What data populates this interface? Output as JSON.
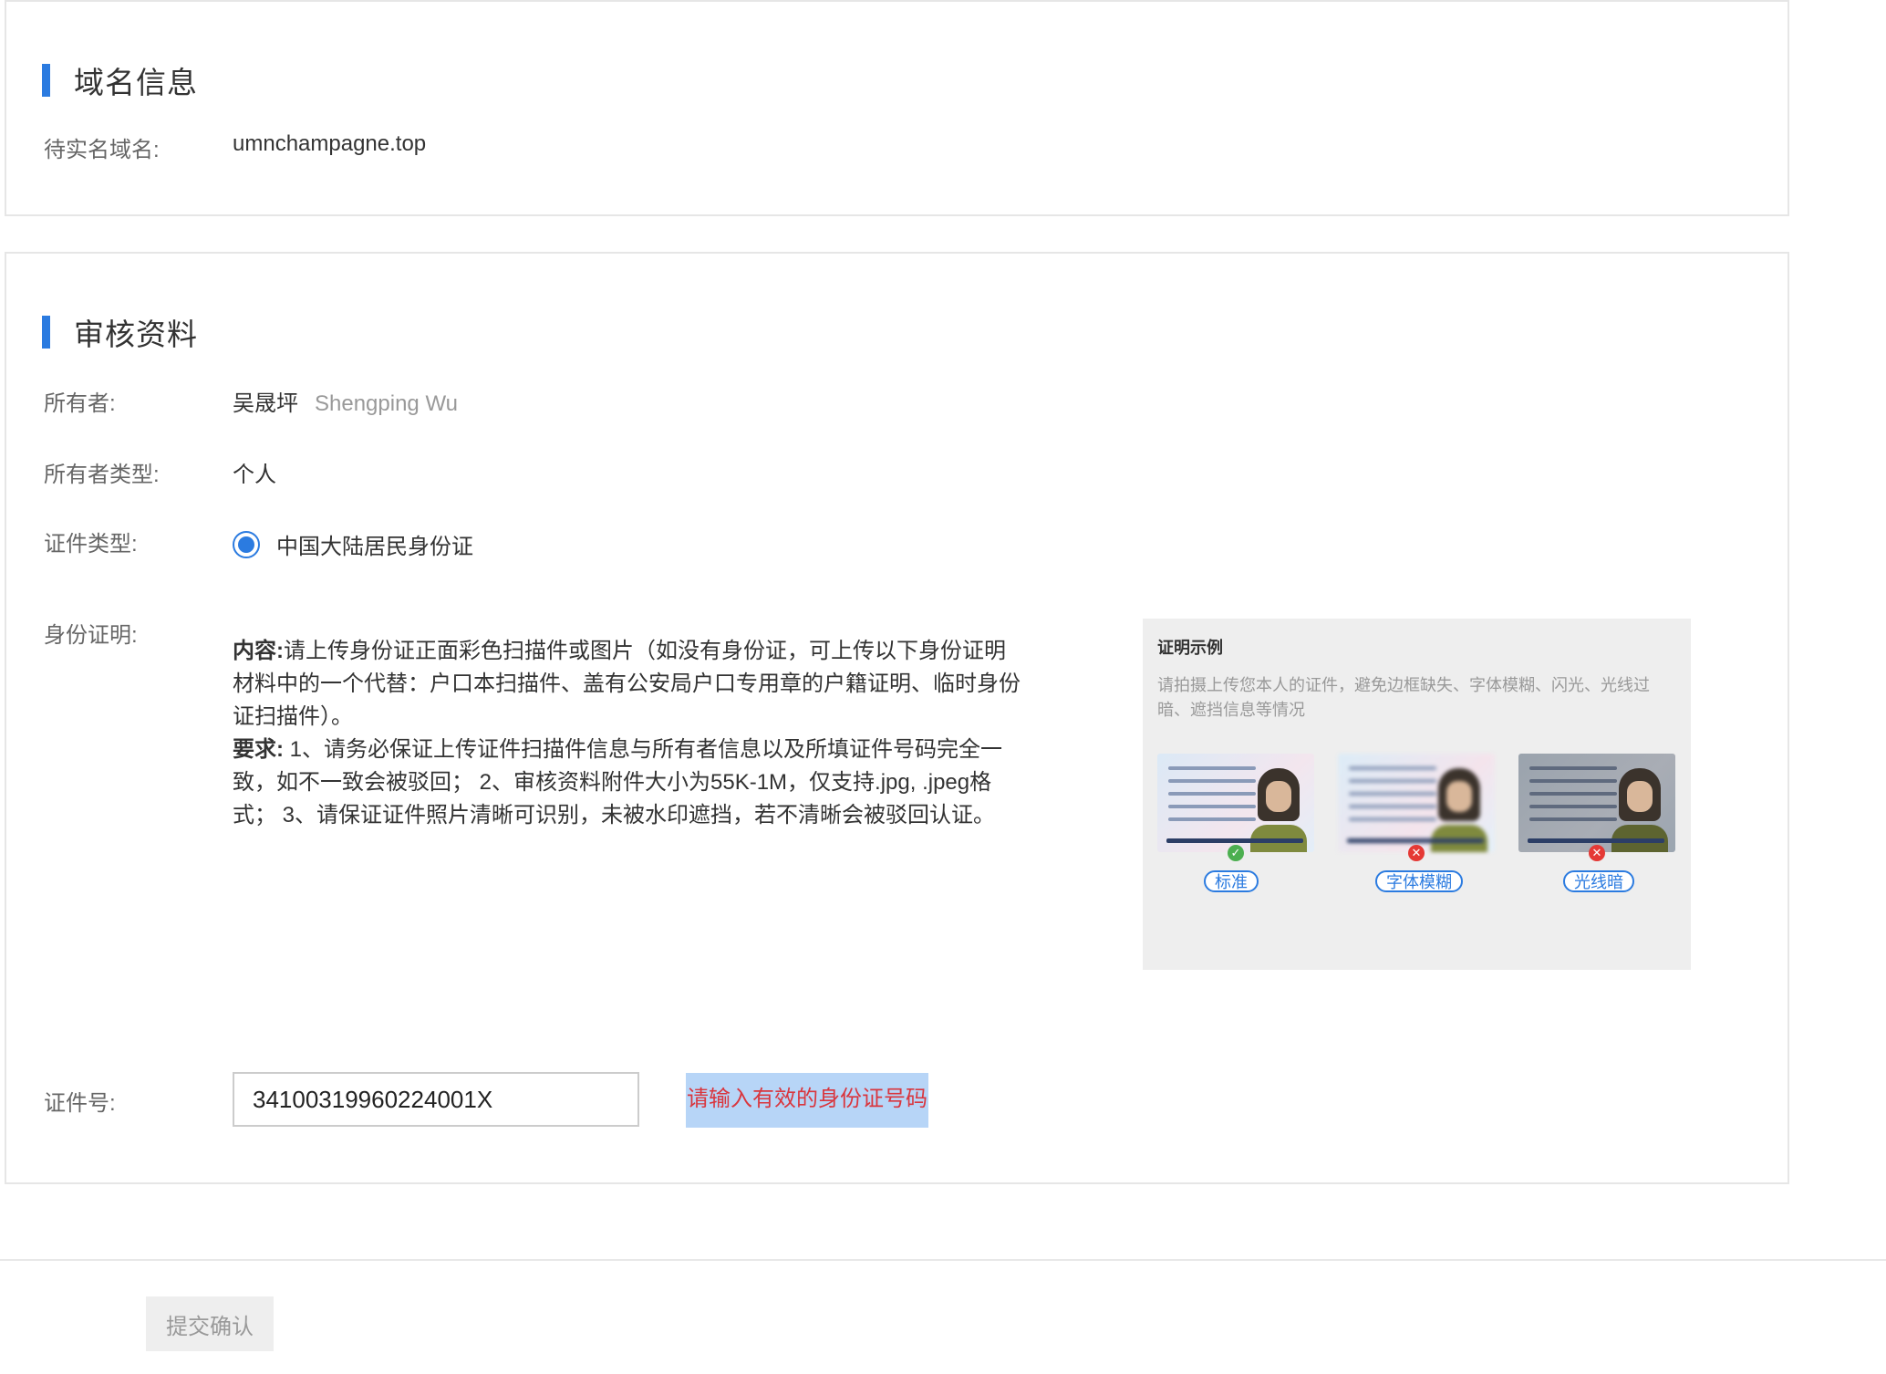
{
  "domain_section": {
    "title": "域名信息",
    "domain_label": "待实名域名:",
    "domain_value": "umnchampagne.top"
  },
  "review_section": {
    "title": "审核资料",
    "owner_label": "所有者:",
    "owner_name": "吴晟坪",
    "owner_pinyin": "Shengping Wu",
    "owner_type_label": "所有者类型:",
    "owner_type_value": "个人",
    "cert_type_label": "证件类型:",
    "cert_type_option": "中国大陆居民身份证",
    "cert_type_selected": true,
    "proof_label": "身份证明:",
    "content_heading": "内容:",
    "content_text": "请上传身份证正面彩色扫描件或图片（如没有身份证，可上传以下身份证明材料中的一个代替：户口本扫描件、盖有公安局户口专用章的户籍证明、临时身份证扫描件）。",
    "requirement_heading": "要求:",
    "requirement_text": " 1、请务必保证上传证件扫描件信息与所有者信息以及所填证件号码完全一致，如不一致会被驳回； 2、审核资料附件大小为55K-1M，仅支持.jpg, .jpeg格式； 3、请保证证件照片清晰可识别，未被水印遮挡，若不清晰会被驳回认证。",
    "example": {
      "title": "证明示例",
      "note": "请拍摄上传您本人的证件，避免边框缺失、字体模糊、闪光、光线过暗、遮挡信息等情况",
      "samples": [
        {
          "label": "标准",
          "status": "ok",
          "icon": "check-icon"
        },
        {
          "label": "字体模糊",
          "status": "bad",
          "icon": "cross-icon"
        },
        {
          "label": "光线暗",
          "status": "bad",
          "icon": "cross-icon"
        }
      ]
    },
    "id_number_label": "证件号:",
    "id_number_value": "34100319960224001X",
    "id_number_error": "请输入有效的身份证号码"
  },
  "footer": {
    "submit_label": "提交确认"
  },
  "colors": {
    "accent": "#2b7be0",
    "error_text": "#d9363e",
    "error_highlight": "#b7d5f7",
    "ok": "#4caf50",
    "bad": "#e53935"
  }
}
